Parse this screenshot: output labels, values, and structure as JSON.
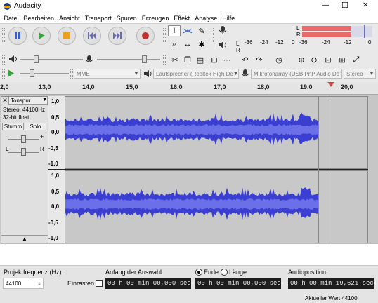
{
  "title": "Audacity",
  "window_buttons": {
    "minimize": "—",
    "maximize": "☐",
    "close": "✕"
  },
  "menu": [
    "Datei",
    "Bearbeiten",
    "Ansicht",
    "Transport",
    "Spuren",
    "Erzeugen",
    "Effekt",
    "Analyse",
    "Hilfe"
  ],
  "transport_icons": [
    "pause-icon",
    "play-icon",
    "stop-icon",
    "skip-start-icon",
    "skip-end-icon",
    "record-icon"
  ],
  "meter": {
    "rec_letter_l": "L",
    "rec_letter_r": "R",
    "play_letter_l": "L",
    "play_letter_r": "R",
    "scale_top": [
      "-36",
      "-24",
      "-12",
      "0"
    ],
    "scale_bottom": [
      "-36",
      "-24",
      "-12",
      "0"
    ]
  },
  "device": {
    "host": "MME",
    "output": "Lautsprecher (Realtek High De",
    "input": "Mikrofonarray (USB PnP Audio De",
    "channels": "Stereo"
  },
  "ruler_ticks": [
    "2,0",
    "13,0",
    "14,0",
    "15,0",
    "16,0",
    "17,0",
    "18,0",
    "19,0",
    "20,0"
  ],
  "track": {
    "name": "Tonspur",
    "info_line1": "Stereo, 44100Hz",
    "info_line2": "32-bit float",
    "mute": "Stumm",
    "solo": "Solo",
    "pan_l": "L",
    "pan_r": "R",
    "gain_minus": "-",
    "gain_plus": "+"
  },
  "vertical_scale": [
    "1,0",
    "0,5",
    "0,0",
    "-0,5",
    "-1,0"
  ],
  "bottom": {
    "project_rate_label": "Projektfrequenz (Hz):",
    "project_rate_value": "44100",
    "snap_label": "Einrasten",
    "selection_start_label": "Anfang der Auswahl:",
    "end_label": "Ende",
    "length_label": "Länge",
    "selection_start_value": "00 h 00 min 00,000 sec",
    "selection_end_value": "00 h 00 min 00,000 sec",
    "audio_position_label": "Audioposition:",
    "audio_position_value": "00 h 00 min 19,621 sec",
    "status": "Aktueller Wert 44100"
  }
}
